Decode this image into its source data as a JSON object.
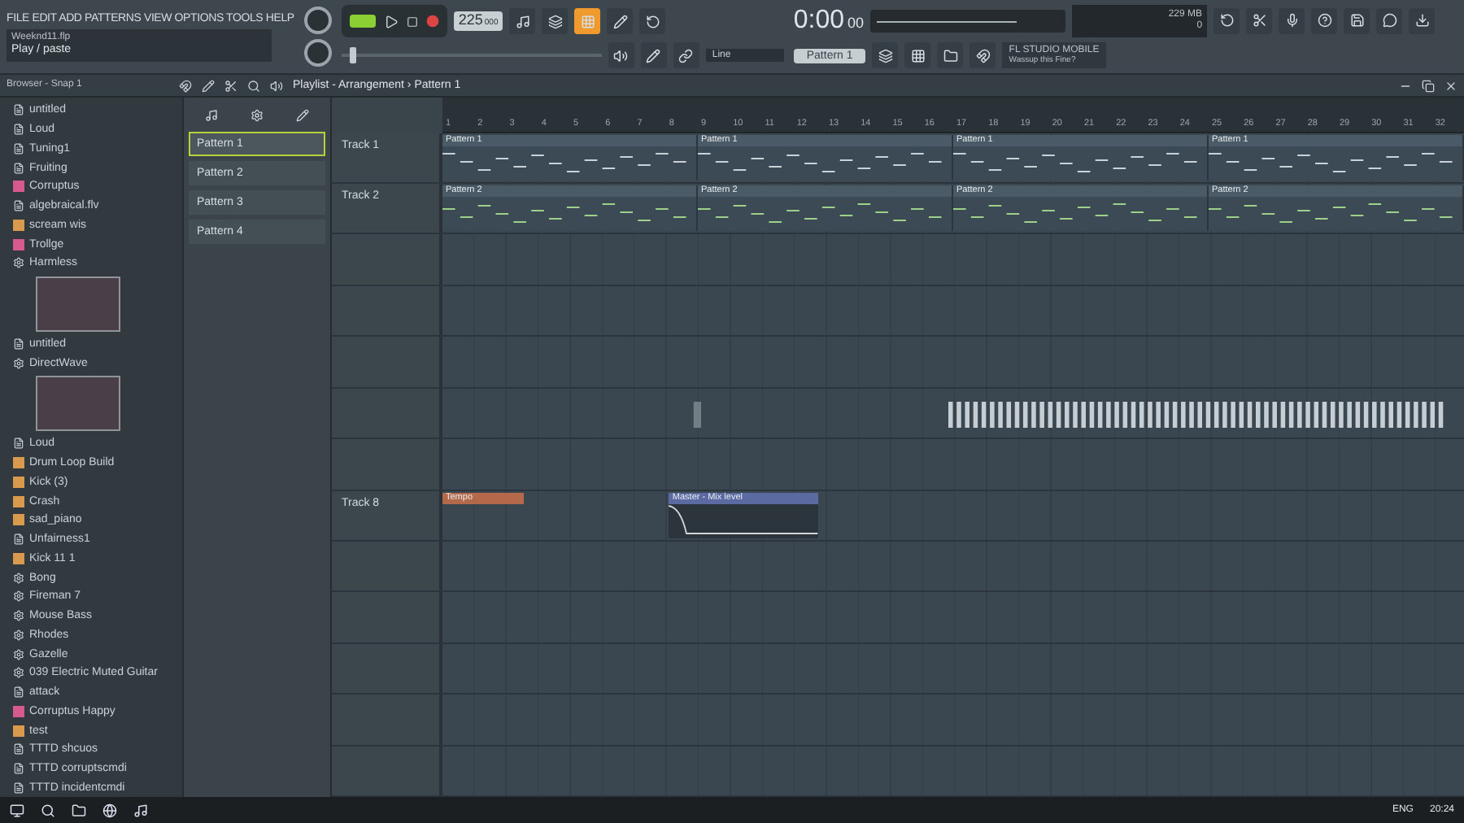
{
  "menu": {
    "text": "FILE EDIT ADD PATTERNS VIEW OPTIONS TOOLS HELP"
  },
  "hint": {
    "file": "Weeknd11.flp",
    "action": "Play / paste"
  },
  "transport": {
    "pattern_mode": true,
    "tempo": "225",
    "tempo_unit": "000",
    "time": "0:00",
    "time_sub": "00",
    "memory": "229 MB",
    "cpu": "0"
  },
  "master_pitch": {
    "level": 0.03
  },
  "toolbar": {
    "snap": "Line",
    "pattern": "Pattern 1",
    "news_title": "FL STUDIO MOBILE",
    "news_text": "Wassup this Fine?"
  },
  "browser": {
    "title": "Browser - Snap 1",
    "items": [
      {
        "label": "untitled",
        "kind": "file"
      },
      {
        "label": "Loud",
        "kind": "file"
      },
      {
        "label": "Tuning1",
        "kind": "file"
      },
      {
        "label": "Fruiting",
        "kind": "file"
      },
      {
        "label": "Corruptus",
        "kind": "pink"
      },
      {
        "label": "algebraical.flv",
        "kind": "file"
      },
      {
        "label": "scream wis",
        "kind": "orange"
      },
      {
        "label": "Trollge",
        "kind": "pink"
      },
      {
        "label": "Harmless",
        "kind": "plugin",
        "thumb": true
      },
      {
        "label": "untitled",
        "kind": "file"
      },
      {
        "label": "DirectWave",
        "kind": "plugin",
        "thumb": true
      },
      {
        "label": "Loud",
        "kind": "file"
      },
      {
        "label": "Drum Loop Build",
        "kind": "orange"
      },
      {
        "label": "Kick (3)",
        "kind": "orange"
      },
      {
        "label": "Crash",
        "kind": "orange"
      },
      {
        "label": "sad_piano",
        "kind": "orange"
      },
      {
        "label": "Unfairness1",
        "kind": "file"
      },
      {
        "label": "Kick 11 1",
        "kind": "orange"
      },
      {
        "label": "Bong",
        "kind": "plugin"
      },
      {
        "label": "Fireman 7",
        "kind": "plugin"
      },
      {
        "label": "Mouse Bass",
        "kind": "plugin"
      },
      {
        "label": "Rhodes",
        "kind": "plugin"
      },
      {
        "label": "Gazelle",
        "kind": "plugin"
      },
      {
        "label": "039 Electric Muted Guitar",
        "kind": "plugin"
      },
      {
        "label": "attack",
        "kind": "file"
      },
      {
        "label": "Corruptus Happy",
        "kind": "pink"
      },
      {
        "label": "test",
        "kind": "orange"
      },
      {
        "label": "TTTD shcuos",
        "kind": "file"
      },
      {
        "label": "TTTD corruptscmdi",
        "kind": "file"
      },
      {
        "label": "TTTD incidentcmdi",
        "kind": "file"
      }
    ]
  },
  "patterns": [
    {
      "label": "Pattern 1",
      "selected": true
    },
    {
      "label": "Pattern 2",
      "selected": false
    },
    {
      "label": "Pattern 3",
      "selected": false
    },
    {
      "label": "Pattern 4",
      "selected": false
    }
  ],
  "playlist": {
    "title": "Playlist - Arrangement › Pattern 1",
    "ruler": [
      "1",
      "2",
      "3",
      "4",
      "5",
      "6",
      "7",
      "8",
      "9",
      "10",
      "11",
      "12",
      "13",
      "14",
      "15",
      "16",
      "17",
      "18",
      "19",
      "20",
      "21",
      "22",
      "23",
      "24",
      "25",
      "26",
      "27",
      "28",
      "29",
      "30",
      "31",
      "32"
    ],
    "tracks": [
      {
        "kind": "track",
        "name": "Track 1",
        "clips": [
          {
            "kind": "pattern",
            "label": "Pattern 1"
          },
          {
            "kind": "pattern",
            "label": "Pattern 1"
          },
          {
            "kind": "pattern",
            "label": "Pattern 1"
          },
          {
            "kind": "pattern",
            "label": "Pattern 1"
          }
        ]
      },
      {
        "kind": "track",
        "name": "Track 2",
        "clips": [
          {
            "kind": "pattern",
            "label": "Pattern 2"
          },
          {
            "kind": "pattern",
            "label": "Pattern 2"
          },
          {
            "kind": "pattern",
            "label": "Pattern 2"
          },
          {
            "kind": "pattern",
            "label": "Pattern 2"
          }
        ]
      },
      {
        "kind": "blank"
      },
      {
        "kind": "blank"
      },
      {
        "kind": "blank"
      },
      {
        "kind": "blank",
        "clips": [
          {
            "kind": "audio"
          },
          {
            "kind": "audio"
          }
        ]
      },
      {
        "kind": "blank"
      },
      {
        "kind": "track",
        "name": "Track 8",
        "clips": [
          {
            "kind": "tempo",
            "label": "Tempo"
          },
          {
            "kind": "automation",
            "label": "Master - Mix level"
          }
        ]
      },
      {
        "kind": "blank"
      },
      {
        "kind": "blank"
      },
      {
        "kind": "blank"
      },
      {
        "kind": "blank"
      },
      {
        "kind": "blank"
      }
    ]
  },
  "taskbar": {
    "language": "ENG",
    "clock": "20:24"
  }
}
